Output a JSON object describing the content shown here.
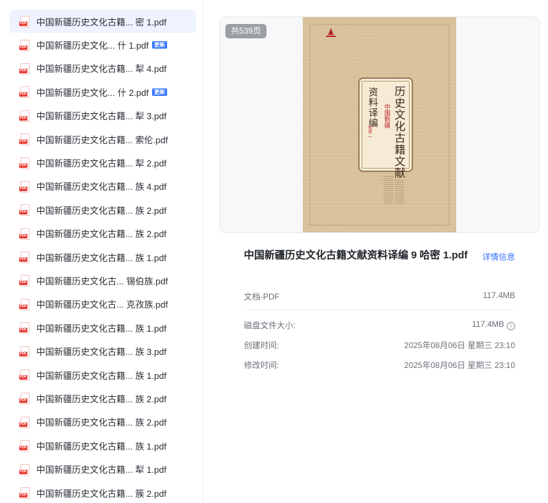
{
  "files": [
    {
      "name": "中国新疆历史文化古籍...  密 1.pdf",
      "active": true,
      "badge": ""
    },
    {
      "name": "中国新疆历史文化...  什 1.pdf",
      "active": false,
      "badge": "更新"
    },
    {
      "name": "中国新疆历史文化古籍...  犁 4.pdf",
      "active": false,
      "badge": ""
    },
    {
      "name": "中国新疆历史文化...  什 2.pdf",
      "active": false,
      "badge": "更新"
    },
    {
      "name": "中国新疆历史文化古籍...  犁 3.pdf",
      "active": false,
      "badge": ""
    },
    {
      "name": "中国新疆历史文化古籍...  索伦.pdf",
      "active": false,
      "badge": ""
    },
    {
      "name": "中国新疆历史文化古籍...  犁 2.pdf",
      "active": false,
      "badge": ""
    },
    {
      "name": "中国新疆历史文化古籍...  族 4.pdf",
      "active": false,
      "badge": ""
    },
    {
      "name": "中国新疆历史文化古籍...  族 2.pdf",
      "active": false,
      "badge": ""
    },
    {
      "name": "中国新疆历史文化古籍...  族 2.pdf",
      "active": false,
      "badge": ""
    },
    {
      "name": "中国新疆历史文化古籍...  族 1.pdf",
      "active": false,
      "badge": ""
    },
    {
      "name": "中国新疆历史文化古...  锡伯族.pdf",
      "active": false,
      "badge": ""
    },
    {
      "name": "中国新疆历史文化古...  克孜族.pdf",
      "active": false,
      "badge": ""
    },
    {
      "name": "中国新疆历史文化古籍...  族 1.pdf",
      "active": false,
      "badge": ""
    },
    {
      "name": "中国新疆历史文化古籍...  族 3.pdf",
      "active": false,
      "badge": ""
    },
    {
      "name": "中国新疆历史文化古籍...  族 1.pdf",
      "active": false,
      "badge": ""
    },
    {
      "name": "中国新疆历史文化古籍...  族 2.pdf",
      "active": false,
      "badge": ""
    },
    {
      "name": "中国新疆历史文化古籍...  族 2.pdf",
      "active": false,
      "badge": ""
    },
    {
      "name": "中国新疆历史文化古籍...  族 1.pdf",
      "active": false,
      "badge": ""
    },
    {
      "name": "中国新疆历史文化古籍...  犁 1.pdf",
      "active": false,
      "badge": ""
    },
    {
      "name": "中国新疆历史文化古籍...  簇 2.pdf",
      "active": false,
      "badge": ""
    }
  ],
  "file_icon_label": "PDF",
  "file_icon": "pdf-file-icon",
  "preview": {
    "page_count": "共539页",
    "cover": {
      "title": "历史文化古籍文献",
      "region": "中国新疆",
      "subtitle": "资料译编",
      "volume": "哈密 一"
    }
  },
  "details": {
    "title": "中国新疆历史文化古籍文献资料译编 9 哈密 1.pdf",
    "detail_link": "详情信息",
    "type_label": "文档-PDF",
    "type_size": "117.4MB",
    "disk_size_label": "磁盘文件大小:",
    "disk_size_value": "117.4MB",
    "created_label": "创建时间:",
    "created_value": "2025年08月06日 星期三 23:10",
    "modified_label": "修改时间:",
    "modified_value": "2025年08月06日 星期三 23:10"
  },
  "colors": {
    "accent": "#3370ff",
    "active_row": "#eef3ff",
    "badge": "#3a7bff",
    "pdf_red": "#e9403a"
  }
}
